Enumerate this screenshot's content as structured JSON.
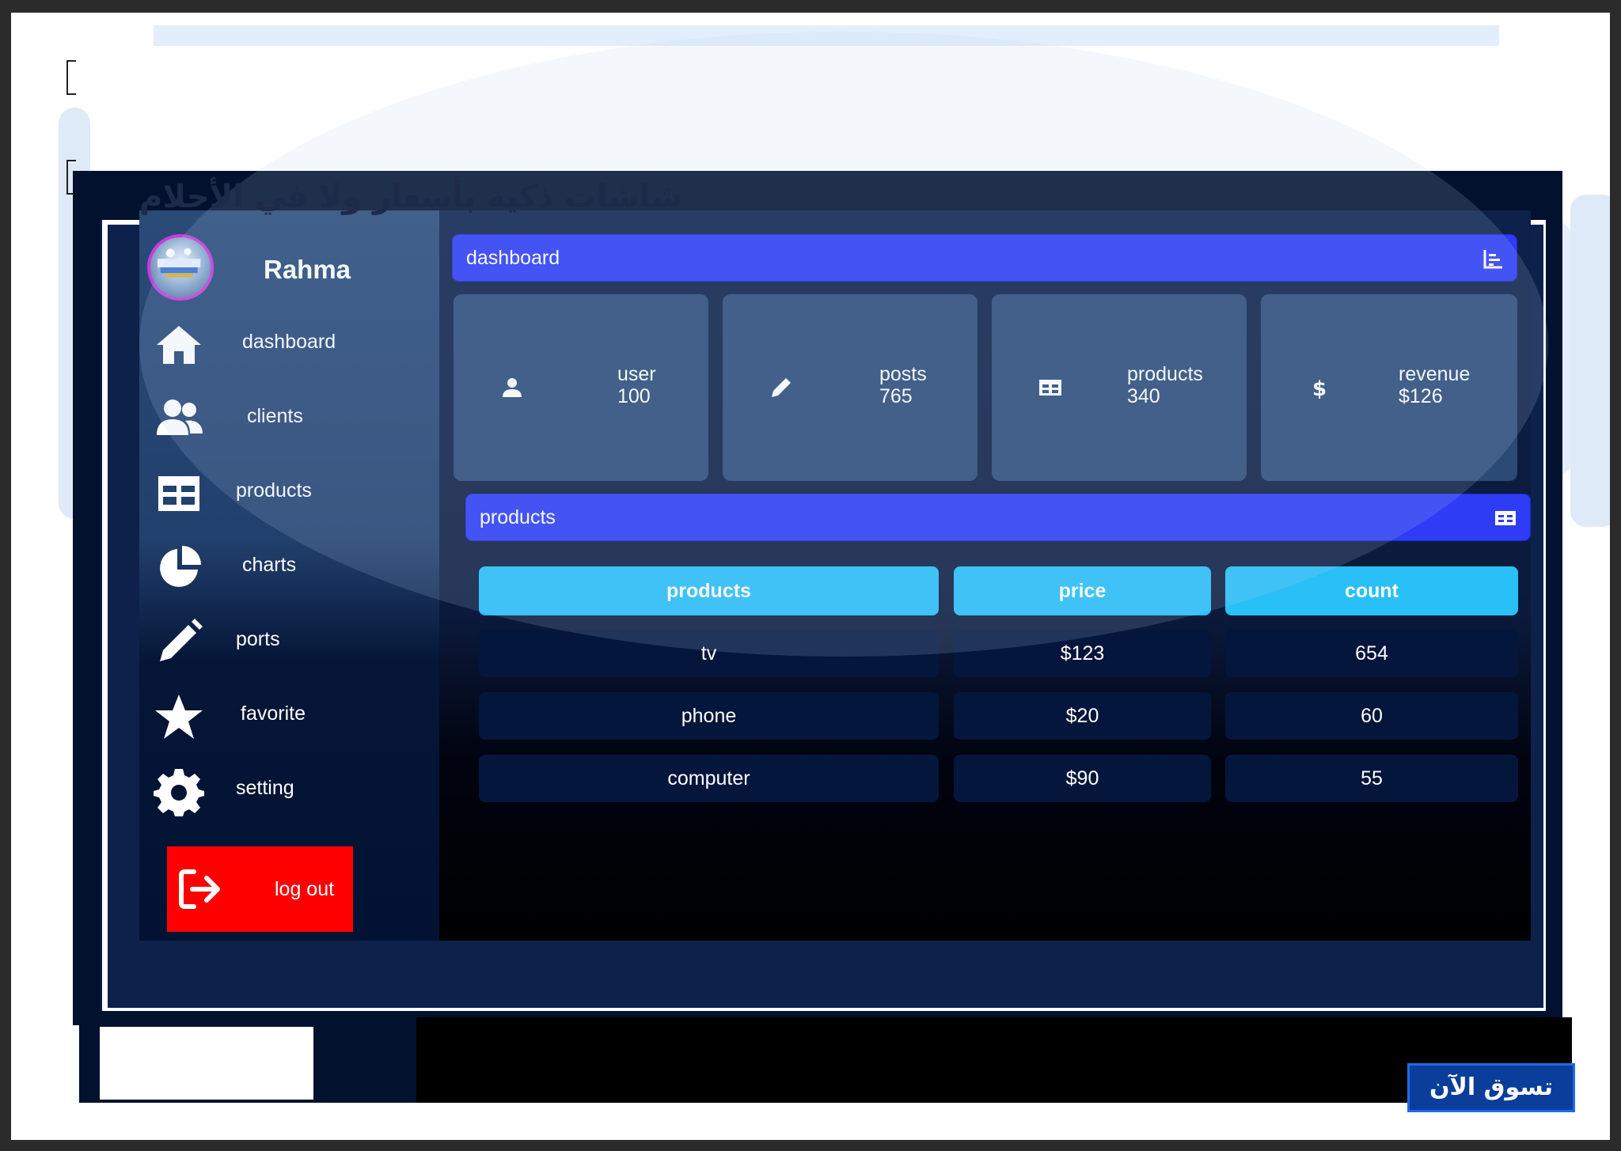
{
  "headline": "شاشات ذكية بأسعار ولا في الأحلام",
  "cta_label": "تسوق الآن",
  "colors": {
    "accent_bar": "#2e3cf5",
    "table_header": "#29bff7",
    "logout": "#ff0000",
    "sidebar": "#2a4a78",
    "avatar_ring": "#c63cdb"
  },
  "profile": {
    "name": "Rahma",
    "avatar_icon": "avatar-photo"
  },
  "sidebar": {
    "items": [
      {
        "label": "dashboard",
        "icon": "home-icon"
      },
      {
        "label": "clients",
        "icon": "users-icon"
      },
      {
        "label": "products",
        "icon": "table-icon"
      },
      {
        "label": "charts",
        "icon": "pie-chart-icon"
      },
      {
        "label": "ports",
        "icon": "pencil-icon"
      },
      {
        "label": "favorite",
        "icon": "star-icon"
      },
      {
        "label": "setting",
        "icon": "gear-icon"
      }
    ],
    "logout_label": "log out",
    "logout_icon": "sign-out-icon"
  },
  "dashboard_bar": {
    "title": "dashboard",
    "icon": "bar-chart-icon"
  },
  "stats": [
    {
      "name": "user",
      "value": "100",
      "icon": "user-icon"
    },
    {
      "name": "posts",
      "value": "765",
      "icon": "pencil-icon"
    },
    {
      "name": "products",
      "value": "340",
      "icon": "table-icon"
    },
    {
      "name": "revenue",
      "value": "$126",
      "icon": "dollar-icon"
    }
  ],
  "products_bar": {
    "title": "products",
    "icon": "table-icon"
  },
  "table": {
    "headers": [
      "products",
      "price",
      "count"
    ],
    "rows": [
      [
        "tv",
        "$123",
        "654"
      ],
      [
        "phone",
        "$20",
        "60"
      ],
      [
        "computer",
        "$90",
        "55"
      ]
    ]
  }
}
